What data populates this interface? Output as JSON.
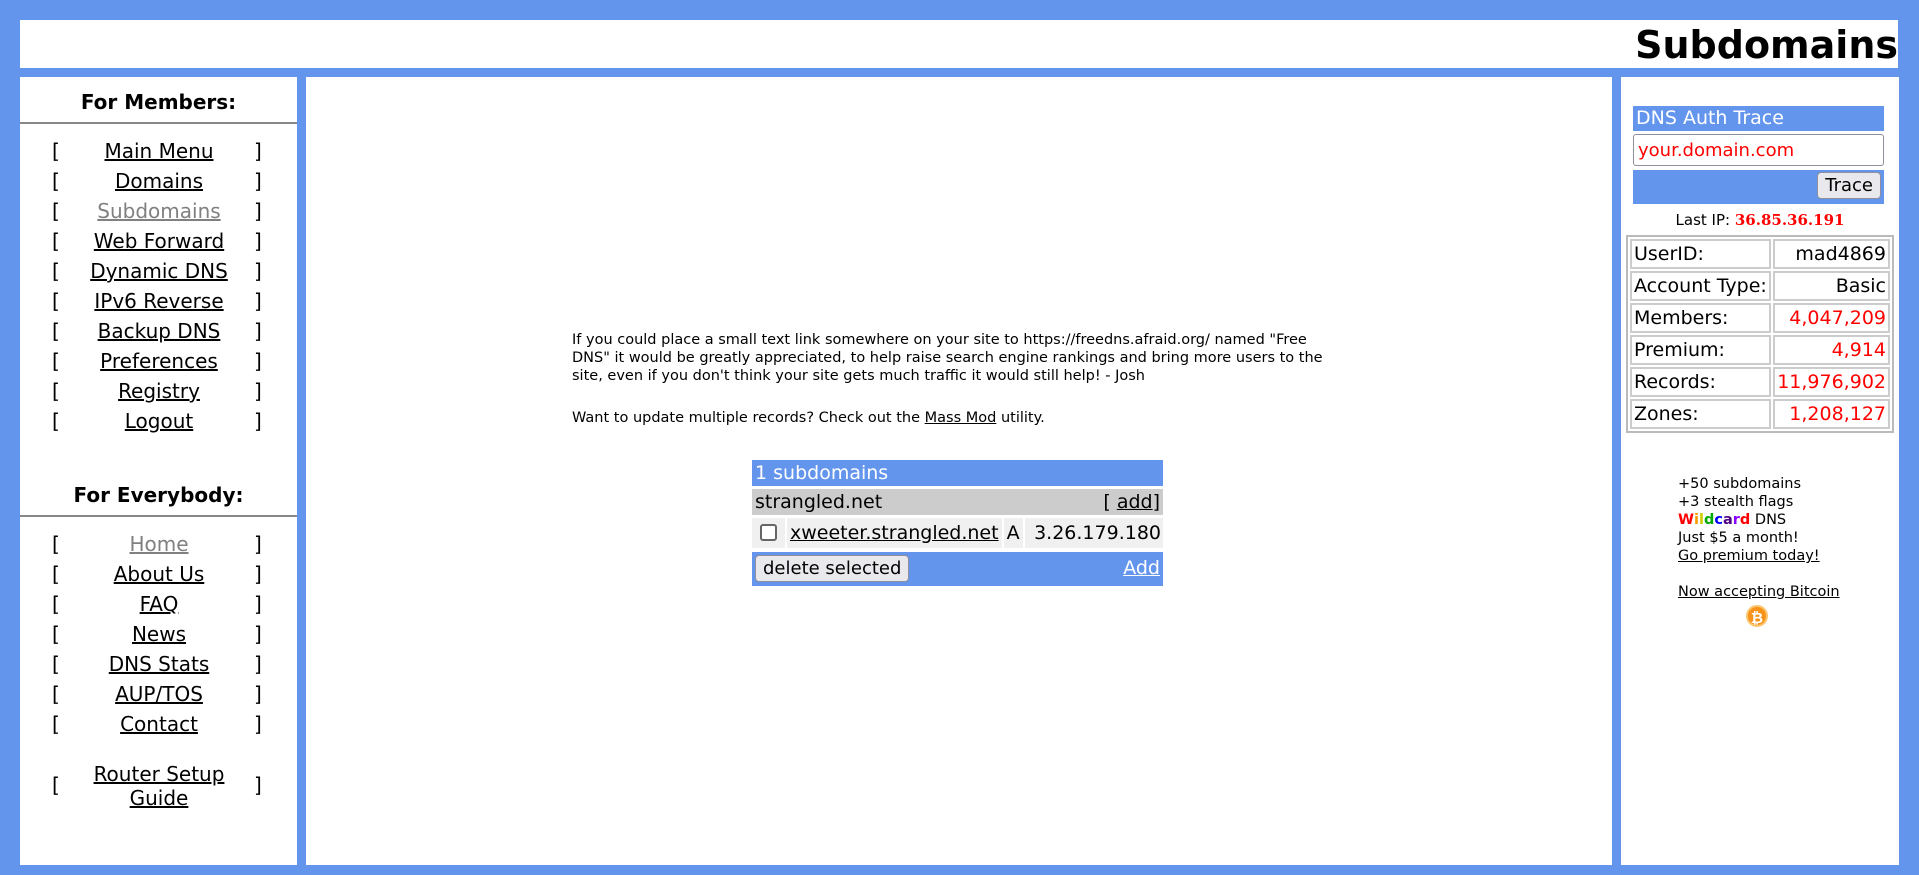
{
  "header": {
    "title": "Subdomains"
  },
  "members": {
    "heading": "For Members:",
    "items": [
      {
        "label": "Main Menu"
      },
      {
        "label": "Domains"
      },
      {
        "label": "Subdomains",
        "current": true
      },
      {
        "label": "Web Forward"
      },
      {
        "label": "Dynamic DNS"
      },
      {
        "label": "IPv6 Reverse"
      },
      {
        "label": "Backup DNS"
      },
      {
        "label": "Preferences"
      },
      {
        "label": "Registry"
      },
      {
        "label": "Logout"
      }
    ]
  },
  "everybody": {
    "heading": "For Everybody:",
    "items": [
      {
        "label": "Home",
        "current": true
      },
      {
        "label": "About Us"
      },
      {
        "label": "FAQ"
      },
      {
        "label": "News"
      },
      {
        "label": "DNS Stats"
      },
      {
        "label": "AUP/TOS"
      },
      {
        "label": "Contact"
      }
    ],
    "router_guide": "Router Setup Guide"
  },
  "bracket_left": "[",
  "bracket_right": "]",
  "main": {
    "intro": "If you could place a small text link somewhere on your site to https://freedns.afraid.org/ named \"Free DNS\" it would be greatly appreciated, to help raise search engine rankings and bring more users to the site, even if you don't think your site gets much traffic it would still help! - Josh",
    "massmod_prefix": "Want to update multiple records? Check out the",
    "massmod_link": "Mass Mod",
    "massmod_suffix": "utility.",
    "table": {
      "count_label": "1 subdomains",
      "domain": "strangled.net",
      "domain_add_open": "[",
      "domain_add": "add",
      "domain_add_close": "]",
      "rows": [
        {
          "host": "xweeter.strangled.net",
          "type": "A",
          "value": "3.26.179.180"
        }
      ],
      "delete_label": "delete selected",
      "add_label": "Add"
    }
  },
  "sidebar_right": {
    "trace_title": "DNS Auth Trace",
    "trace_value": "your.domain.com",
    "trace_button": "Trace",
    "last_ip_label": "Last IP:",
    "last_ip": "36.85.36.191",
    "stats": [
      {
        "key": "UserID:",
        "value": "mad4869",
        "red": false
      },
      {
        "key": "Account Type:",
        "value": "Basic",
        "red": false
      },
      {
        "key": "Members:",
        "value": "4,047,209",
        "red": true
      },
      {
        "key": "Premium:",
        "value": "4,914",
        "red": true
      },
      {
        "key": "Records:",
        "value": "11,976,902",
        "red": true
      },
      {
        "key": "Zones:",
        "value": "1,208,127",
        "red": true
      }
    ],
    "promo": {
      "line1": "+50 subdomains",
      "line2": "+3 stealth flags",
      "wildcard_letters": [
        "W",
        "i",
        "l",
        "d",
        "c",
        "a",
        "r",
        "d"
      ],
      "wildcard_colors": [
        "#ff0000",
        "#ff9900",
        "#cccc00",
        "#00aa00",
        "#0000ff",
        "#4b0082",
        "#8b00ff",
        "#ff0000"
      ],
      "dns": "DNS",
      "line4": "Just $5 a month!",
      "premium_link": "Go premium today!",
      "bitcoin_link": "Now accepting Bitcoin"
    }
  }
}
